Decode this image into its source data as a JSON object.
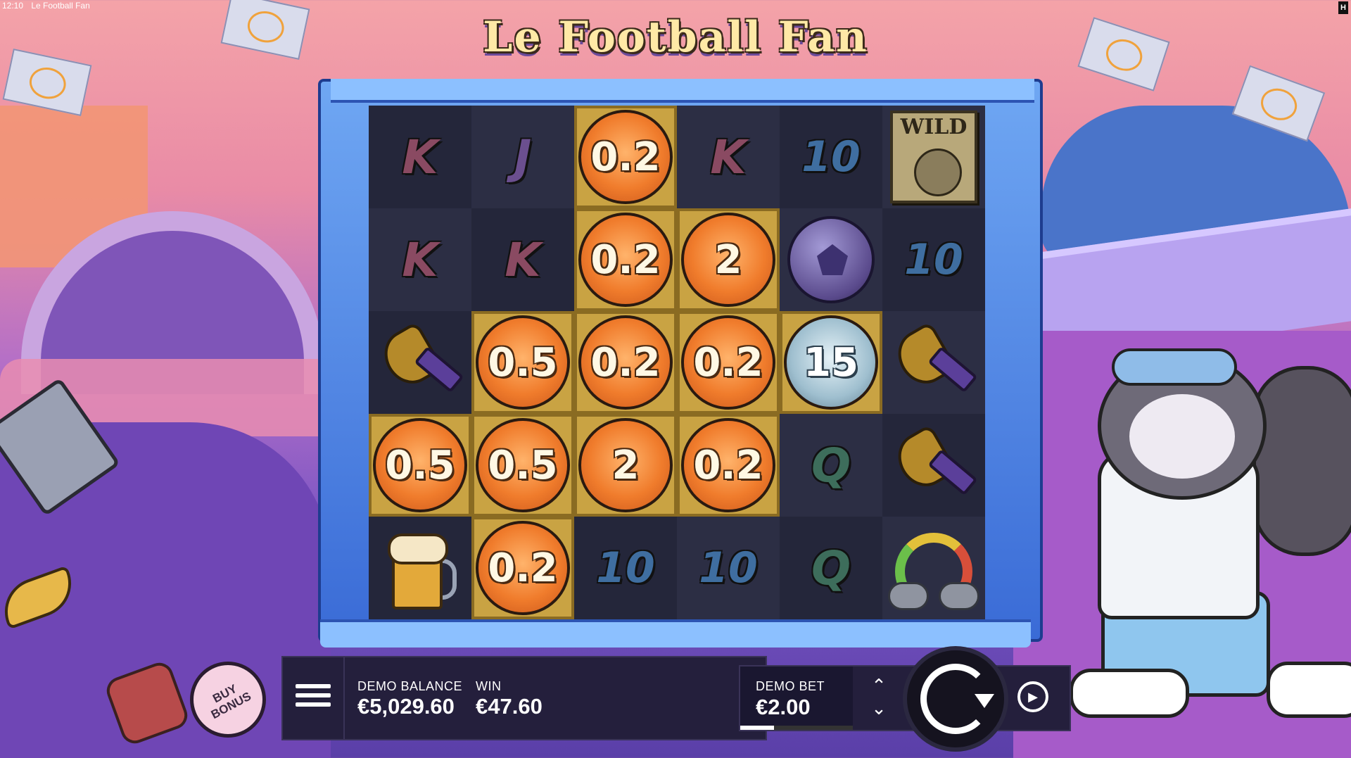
{
  "status_bar": {
    "time": "12:10",
    "window_title": "Le Football Fan",
    "corner_logo": "H"
  },
  "game": {
    "title": "Le Football Fan"
  },
  "reels": {
    "rows": [
      [
        {
          "type": "letter",
          "value": "K"
        },
        {
          "type": "letter",
          "value": "J"
        },
        {
          "type": "coin",
          "value": "0.2",
          "highlight": true
        },
        {
          "type": "letter",
          "value": "K"
        },
        {
          "type": "letter",
          "value": "10"
        },
        {
          "type": "wild",
          "value": "WILD"
        }
      ],
      [
        {
          "type": "letter",
          "value": "K"
        },
        {
          "type": "letter",
          "value": "K"
        },
        {
          "type": "coin",
          "value": "0.2",
          "highlight": true
        },
        {
          "type": "coin",
          "value": "2",
          "highlight": true
        },
        {
          "type": "ball",
          "icon": "football-icon"
        },
        {
          "type": "letter",
          "value": "10"
        }
      ],
      [
        {
          "type": "horn",
          "icon": "vuvuzela-icon"
        },
        {
          "type": "coin",
          "value": "0.5",
          "highlight": true
        },
        {
          "type": "coin",
          "value": "0.2",
          "highlight": true
        },
        {
          "type": "coin",
          "value": "0.2",
          "highlight": true
        },
        {
          "type": "silver-coin",
          "value": "15",
          "highlight": true
        },
        {
          "type": "horn",
          "icon": "vuvuzela-icon"
        }
      ],
      [
        {
          "type": "coin",
          "value": "0.5",
          "highlight": true
        },
        {
          "type": "coin",
          "value": "0.5",
          "highlight": true
        },
        {
          "type": "coin",
          "value": "2",
          "highlight": true
        },
        {
          "type": "coin",
          "value": "0.2",
          "highlight": true
        },
        {
          "type": "letter",
          "value": "Q"
        },
        {
          "type": "horn",
          "icon": "vuvuzela-icon"
        }
      ],
      [
        {
          "type": "beer",
          "icon": "beer-mug-icon"
        },
        {
          "type": "coin",
          "value": "0.2",
          "highlight": true
        },
        {
          "type": "letter",
          "value": "10"
        },
        {
          "type": "letter",
          "value": "10"
        },
        {
          "type": "letter",
          "value": "Q"
        },
        {
          "type": "rainbow",
          "icon": "rainbow-icon"
        }
      ]
    ]
  },
  "hud": {
    "balance_label": "DEMO BALANCE",
    "balance_value": "€5,029.60",
    "win_label": "WIN",
    "win_value": "€47.60",
    "bet_label": "DEMO BET",
    "bet_value": "€2.00",
    "bet_level_fraction": 0.3,
    "buy_bonus_label": "BUY BONUS"
  }
}
